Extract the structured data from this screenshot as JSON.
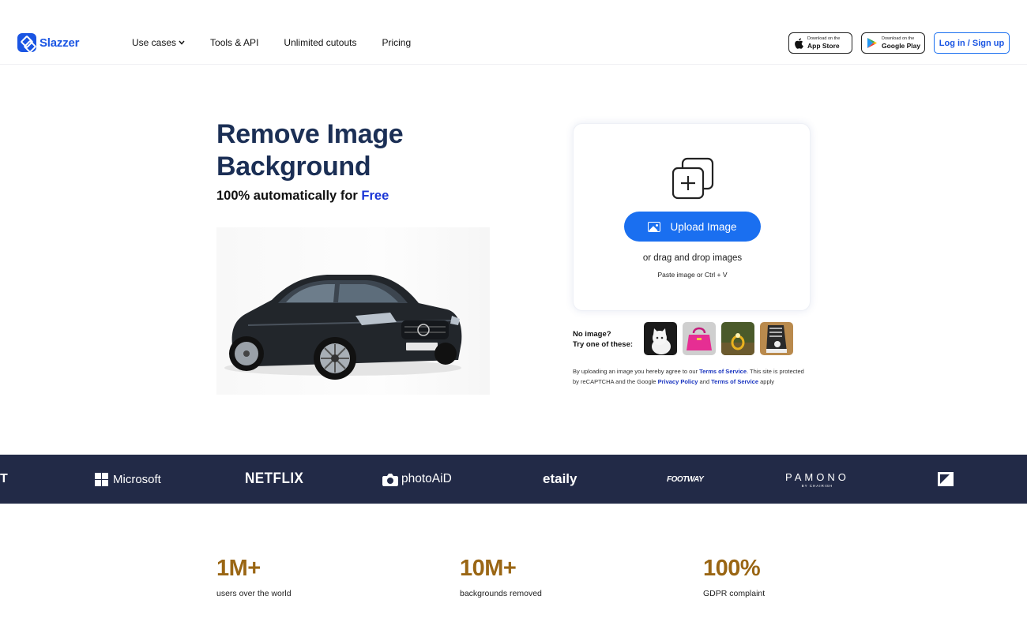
{
  "header": {
    "logo_text": "Slazzer",
    "nav": [
      {
        "label": "Use cases",
        "has_dropdown": true
      },
      {
        "label": "Tools & API"
      },
      {
        "label": "Unlimited cutouts"
      },
      {
        "label": "Pricing"
      }
    ],
    "app_store": {
      "small": "Download on the",
      "big": "App Store"
    },
    "google_play": {
      "small": "Download on the",
      "big": "Google Play"
    },
    "login_label": "Log in / Sign up"
  },
  "hero": {
    "title_line1": "Remove Image",
    "title_line2": "Background",
    "subtitle_prefix": "100% automatically for ",
    "subtitle_highlight": "Free"
  },
  "upload": {
    "button_label": "Upload Image",
    "drag_text": "or drag and drop images",
    "paste_text": "Paste image or Ctrl + V",
    "no_image_line1": "No image?",
    "no_image_line2": "Try one of these:",
    "samples": [
      "kitten",
      "pink-handbag",
      "ring",
      "sneaker"
    ]
  },
  "terms": {
    "part1": "By uploading an image you hereby agree to our ",
    "link1": "Terms of Service",
    "part2": ". This site is protected by reCAPTCHA and the Google ",
    "link2": "Privacy Policy",
    "part3": " and ",
    "link3": "Terms of Service",
    "part4": " apply"
  },
  "brands": {
    "partial": "T",
    "microsoft": "Microsoft",
    "netflix": "NETFLIX",
    "photoaid": "photoAiD",
    "etaily": "etaily",
    "footway": "FOOTWAY",
    "pamono": "PAMONO",
    "pamono_sub": "BY CHAIRISH"
  },
  "stats": [
    {
      "value": "1M+",
      "label": "users over the world"
    },
    {
      "value": "10M+",
      "label": "backgrounds removed"
    },
    {
      "value": "100%",
      "label": "GDPR complaint"
    }
  ],
  "colors": {
    "brand_blue": "#1a55e3",
    "button_blue": "#1a6ff0",
    "title_navy": "#1b2f55",
    "strip_navy": "#222a47",
    "stat_gold": "#9a6614"
  }
}
